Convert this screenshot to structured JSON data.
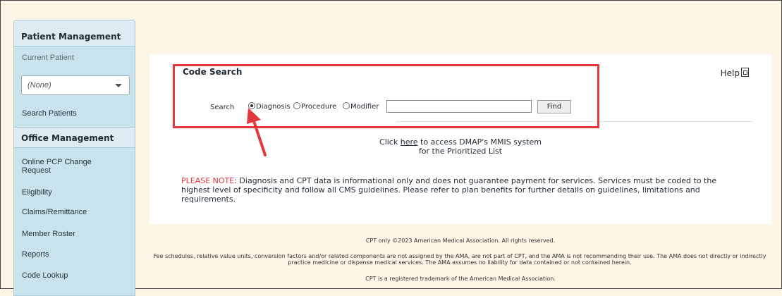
{
  "sidebar": {
    "patient_header": "Patient Management",
    "current_patient_label": "Current Patient",
    "current_patient_value": "(None)",
    "search_patients": "Search Patients",
    "office_header": "Office Management",
    "items": [
      {
        "label": "Online PCP Change Request"
      },
      {
        "label": "Eligibility"
      },
      {
        "label": "Claims/Remittance"
      },
      {
        "label": "Member Roster"
      },
      {
        "label": "Reports"
      },
      {
        "label": "Code Lookup"
      }
    ]
  },
  "main": {
    "title": "Code Search",
    "help": "Help",
    "search_label": "Search",
    "radios": [
      {
        "label": "Diagnosis",
        "checked": true
      },
      {
        "label": "Procedure",
        "checked": false
      },
      {
        "label": "Modifier",
        "checked": false
      }
    ],
    "search_value": "",
    "find_button": "Find",
    "click_prefix": "Click ",
    "click_link": "here",
    "click_suffix": " to access DMAP's MMIS system",
    "click_line2": "for the Prioritized List",
    "note_label": "PLEASE NOTE",
    "note_text": ": Diagnosis and CPT data is informational only and does not guarantee payment for services.  Services must be coded to the highest level of specificity and follow all CMS guidelines.  Please refer to plan benefits for further details on guidelines, limitations and requirements."
  },
  "footer": {
    "line1": "CPT only ©2023 American Medical Association. All rights reserved.",
    "line2": "Fee schedules, relative value units, conversion factors and/or related components are not assigned by the AMA, are not part of CPT, and the AMA is not recommending their use. The AMA does not directly or indirectly practice medicine or dispense medical services. The AMA assumes no liability for data contained or not contained herein.",
    "line3": "CPT is a registered trademark of the American Medical Association."
  },
  "colors": {
    "annotation": "#e0383c",
    "sidebar": "#c8e3ec",
    "background": "#fdf5e6"
  }
}
